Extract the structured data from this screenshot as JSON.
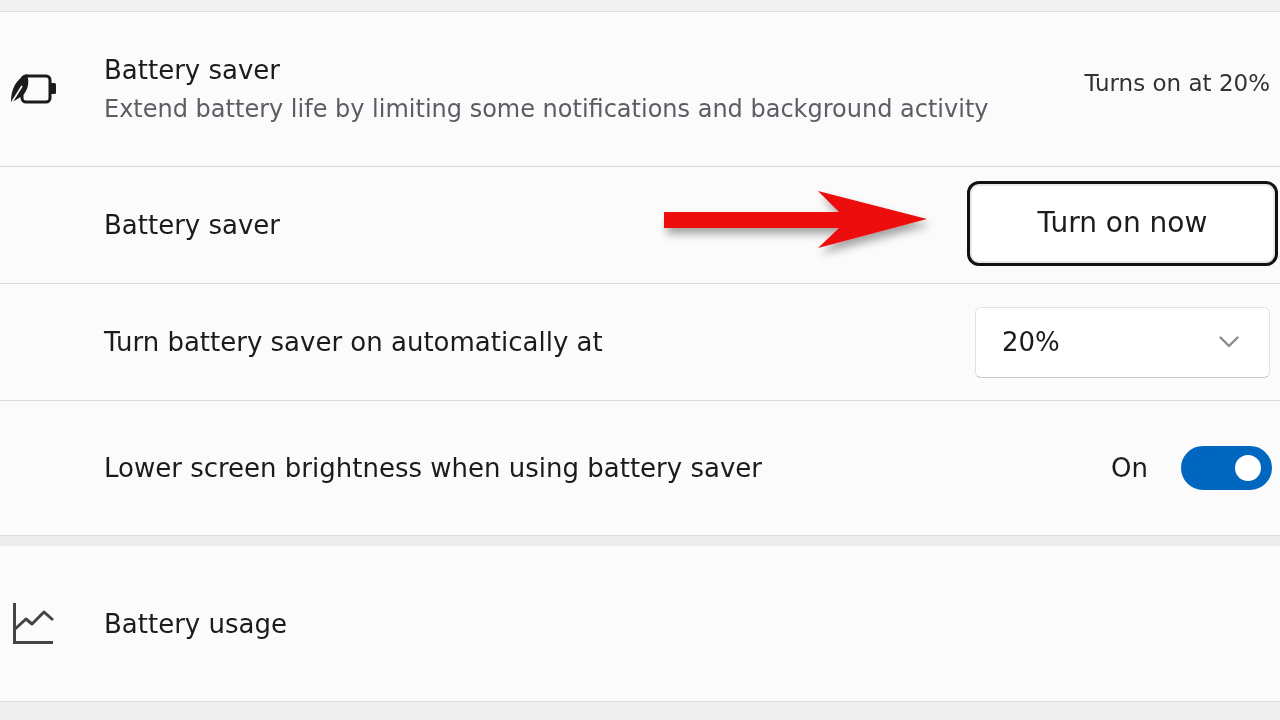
{
  "battery_saver": {
    "title": "Battery saver",
    "description": "Extend battery life by limiting some notifications and background activity",
    "status": "Turns on at 20%",
    "settings": [
      {
        "kind": "button",
        "label": "Battery saver",
        "button": "Turn on now",
        "focused": true,
        "arrow_annotation": true
      },
      {
        "kind": "dropdown",
        "label": "Turn battery saver on automatically at",
        "value": "20%"
      },
      {
        "kind": "toggle",
        "label": "Lower screen brightness when using battery saver",
        "state_label": "On",
        "on": true
      }
    ]
  },
  "battery_usage": {
    "title": "Battery usage"
  }
}
